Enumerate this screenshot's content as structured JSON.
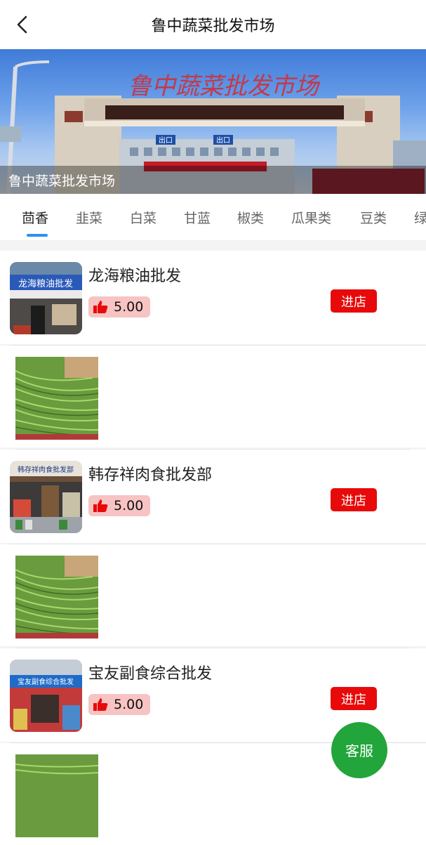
{
  "header": {
    "title": "鲁中蔬菜批发市场"
  },
  "banner": {
    "caption": "鲁中蔬菜批发市场",
    "sign_text": "鲁中蔬菜批发市场",
    "exit_left": "出口",
    "exit_right": "出口"
  },
  "tabs": [
    "茴香",
    "韭菜",
    "白菜",
    "甘蓝",
    "椒类",
    "瓜果类",
    "豆类",
    "绿"
  ],
  "active_tab": "茴香",
  "shops": [
    {
      "name": "龙海粮油批发",
      "rating": "5.00",
      "enter_label": "进店",
      "thumb_text": "龙海粮油批发"
    },
    {
      "name": "韩存祥肉食批发部",
      "rating": "5.00",
      "enter_label": "进店",
      "thumb_text": "韩存祥肉食批发部"
    },
    {
      "name": "宝友副食综合批发",
      "rating": "5.00",
      "enter_label": "进店",
      "thumb_text": "宝友副食综合批发"
    }
  ],
  "service_label": "客服",
  "colors": {
    "accent_blue": "#2f8ff2",
    "enter_red": "#e80a0a",
    "rating_bg": "#f7c3c3",
    "service_green": "#22a53a"
  }
}
